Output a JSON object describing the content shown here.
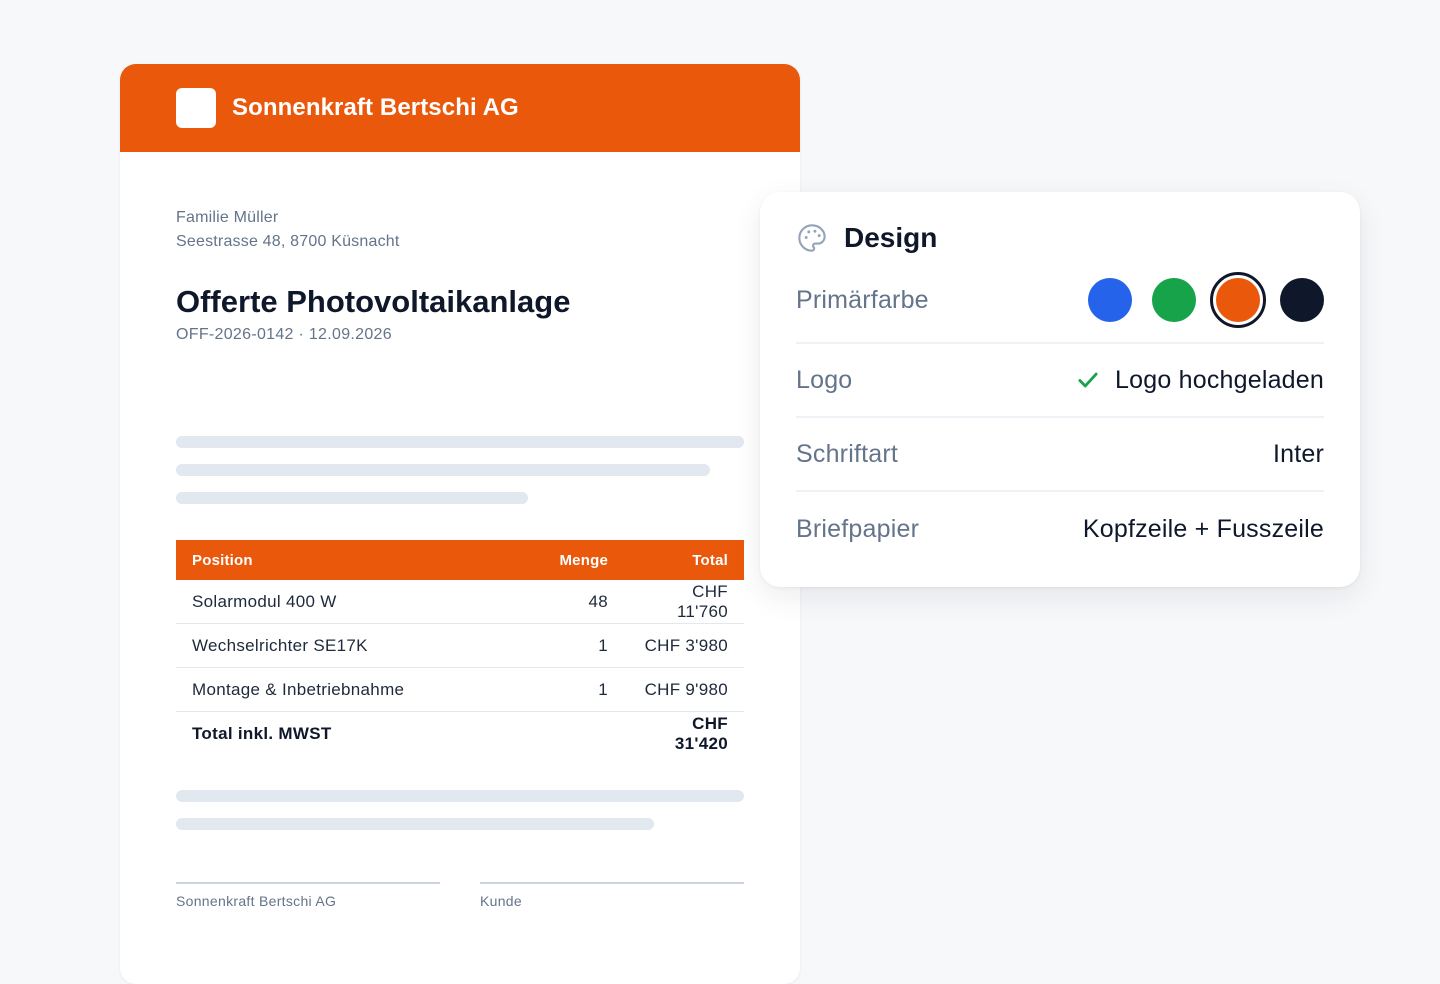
{
  "document": {
    "company_name": "Sonnenkraft Bertschi AG",
    "brand_color": "#ea580c",
    "recipient": {
      "name": "Familie Müller",
      "address": "Seestrasse 48, 8700 Küsnacht"
    },
    "title": "Offerte Photovoltaikanlage",
    "reference": "OFF-2026-0142 · 12.09.2026",
    "table": {
      "headers": [
        "Position",
        "Menge",
        "Total"
      ],
      "rows": [
        {
          "position": "Solarmodul 400 W",
          "menge": "48",
          "total": "CHF 11'760"
        },
        {
          "position": "Wechselrichter SE17K",
          "menge": "1",
          "total": "CHF 3'980"
        },
        {
          "position": "Montage & Inbetriebnahme",
          "menge": "1",
          "total": "CHF 9'980"
        }
      ],
      "total_label": "Total inkl. MWST",
      "total_value": "CHF 31'420"
    },
    "signatures": {
      "left": "Sonnenkraft Bertschi AG",
      "right": "Kunde"
    }
  },
  "design_panel": {
    "title": "Design",
    "icon": "palette-icon",
    "rows": {
      "primary_color": {
        "label": "Primärfarbe",
        "swatches": [
          "#2563eb",
          "#16a34a",
          "#ea580c",
          "#0f172a"
        ],
        "selected": "#ea580c"
      },
      "logo": {
        "label": "Logo",
        "value": "Logo hochgeladen",
        "icon": "check-icon"
      },
      "font": {
        "label": "Schriftart",
        "value": "Inter"
      },
      "letterhead": {
        "label": "Briefpapier",
        "value": "Kopfzeile + Fusszeile"
      }
    }
  }
}
